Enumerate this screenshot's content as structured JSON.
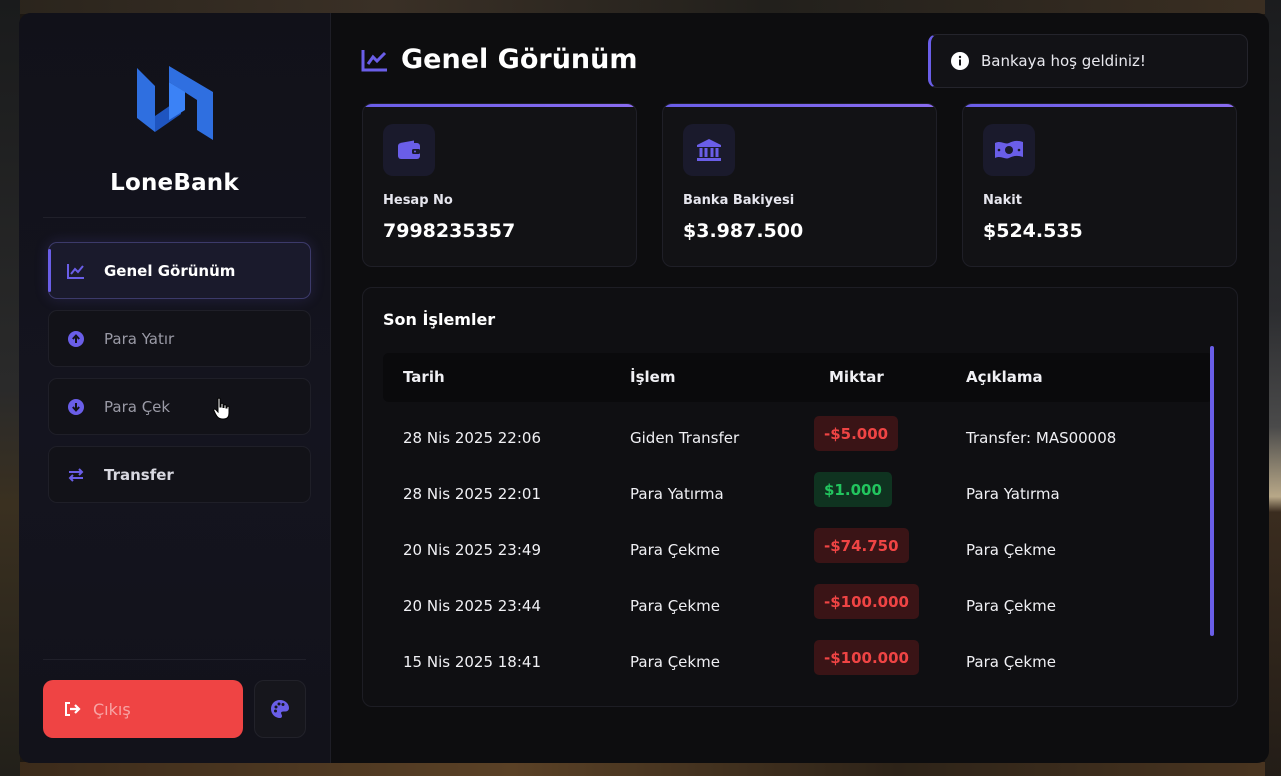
{
  "app": {
    "brand": "LoneBank"
  },
  "colors": {
    "accent": "#6a5ee8",
    "danger": "#ef4444",
    "success": "#22c55e",
    "logo_blue": "#2f6fe0"
  },
  "sidebar": {
    "items": [
      {
        "label": "Genel Görünüm",
        "icon": "chart-line-icon",
        "active": true
      },
      {
        "label": "Para Yatır",
        "icon": "arrow-up-circle-icon",
        "active": false
      },
      {
        "label": "Para Çek",
        "icon": "arrow-down-circle-icon",
        "active": false
      },
      {
        "label": "Transfer",
        "icon": "exchange-arrows-icon",
        "active": false
      }
    ],
    "logout_label": "Çıkış",
    "theme_icon": "palette-icon"
  },
  "header": {
    "title": "Genel Görünüm",
    "title_icon": "chart-line-icon"
  },
  "toast": {
    "message": "Bankaya hoş geldiniz!",
    "icon": "info-icon"
  },
  "cards": [
    {
      "label": "Hesap No",
      "value": "7998235357",
      "icon": "wallet-icon"
    },
    {
      "label": "Banka Bakiyesi",
      "value": "$3.987.500",
      "icon": "bank-icon"
    },
    {
      "label": "Nakit",
      "value": "$524.535",
      "icon": "cash-icon"
    }
  ],
  "transactions": {
    "title": "Son İşlemler",
    "columns": [
      "Tarih",
      "İşlem",
      "Miktar",
      "Açıklama"
    ],
    "rows": [
      {
        "date": "28 Nis 2025 22:06",
        "type": "Giden Transfer",
        "amount": "-$5.000",
        "kind": "neg",
        "description": "Transfer: MAS00008"
      },
      {
        "date": "28 Nis 2025 22:01",
        "type": "Para Yatırma",
        "amount": "$1.000",
        "kind": "pos",
        "description": "Para Yatırma"
      },
      {
        "date": "20 Nis 2025 23:49",
        "type": "Para Çekme",
        "amount": "-$74.750",
        "kind": "neg",
        "description": "Para Çekme"
      },
      {
        "date": "20 Nis 2025 23:44",
        "type": "Para Çekme",
        "amount": "-$100.000",
        "kind": "neg",
        "description": "Para Çekme"
      },
      {
        "date": "15 Nis 2025 18:41",
        "type": "Para Çekme",
        "amount": "-$100.000",
        "kind": "neg",
        "description": "Para Çekme"
      }
    ]
  }
}
